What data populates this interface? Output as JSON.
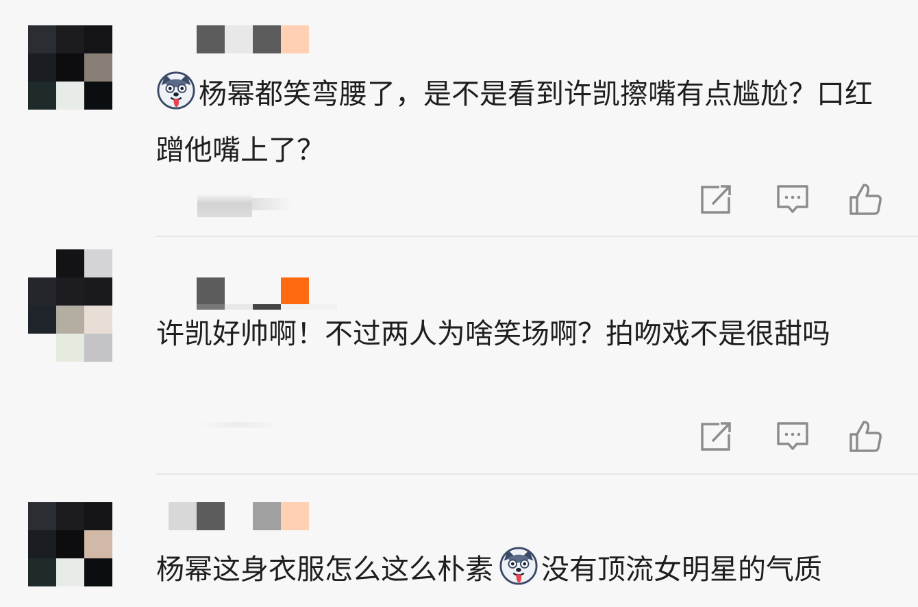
{
  "comments": [
    {
      "text_after_emoji": "杨幂都笑弯腰了，是不是看到许凯擦嘴有点尴尬？口红蹭他嘴上了？",
      "emoji": "husky-emoji-icon"
    },
    {
      "text": "许凯好帅啊！不过两人为啥笑场啊？拍吻戏不是很甜吗"
    },
    {
      "text_before_emoji": "杨幂这身衣服怎么这么朴素",
      "text_after_emoji": "没有顶流女明星的气质",
      "emoji": "husky-emoji-icon"
    }
  ],
  "icons": {
    "share": "share-icon",
    "comment": "comment-icon",
    "like": "like-icon"
  },
  "colors": {
    "background": "#f7f7f7",
    "text": "#1e1e1e",
    "icon": "#8c8c8c",
    "divider": "#e6e6e6"
  }
}
